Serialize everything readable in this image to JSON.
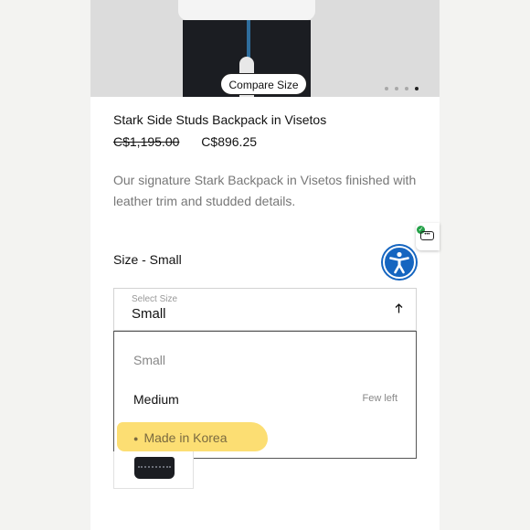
{
  "hero": {
    "compare_label": "Compare Size",
    "carousel": {
      "count": 4,
      "active_index": 3
    }
  },
  "product": {
    "title": "Stark Side Studs Backpack in Visetos",
    "price_original": "C$1,195.00",
    "price_sale": "C$896.25",
    "description": "Our signature Stark Backpack in Visetos finished with leather trim and studded details."
  },
  "size": {
    "label": "Size - Small",
    "select_caption": "Select Size",
    "select_value": "Small",
    "arrow_icon": "arrow-up-icon",
    "options": [
      {
        "label": "Small",
        "note": ""
      },
      {
        "label": "Medium",
        "note": "Few left"
      }
    ],
    "highlighted_note": "Made in Korea",
    "highlight_color": "#fcd85a"
  },
  "widgets": {
    "chat_icon": "chat-bubble-icon",
    "accessibility_icon": "accessibility-icon",
    "accessibility_color": "#1565c0",
    "verified_color": "#24a148"
  }
}
